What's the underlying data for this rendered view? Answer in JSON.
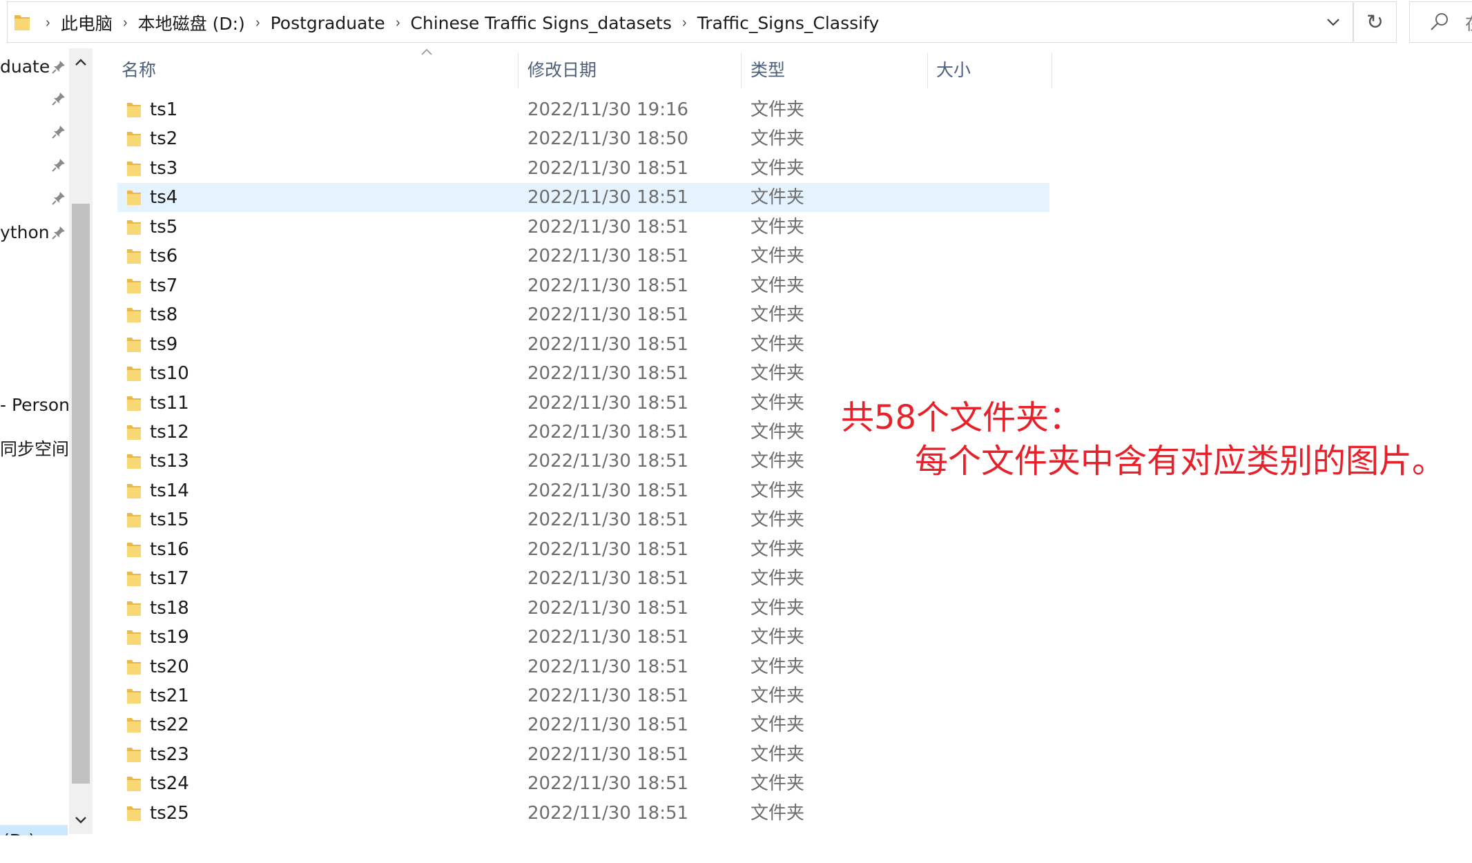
{
  "address_bar": {
    "crumbs": [
      "此电脑",
      "本地磁盘 (D:)",
      "Postgraduate",
      "Chinese Traffic Signs_datasets",
      "Traffic_Signs_Classify"
    ],
    "refresh_glyph": "↻",
    "search_partial_text": "在"
  },
  "nav": {
    "items": [
      {
        "label": "duate",
        "pinned": true
      },
      {
        "label": "",
        "pinned": true
      },
      {
        "label": "",
        "pinned": true
      },
      {
        "label": "",
        "pinned": true
      },
      {
        "label": "",
        "pinned": true
      },
      {
        "label": "ython",
        "pinned": true
      }
    ],
    "onedrive_label": "- Persona",
    "sync_label": "同步空间",
    "drive_label": "(D:)"
  },
  "columns": {
    "name": "名称",
    "date": "修改日期",
    "type": "类型",
    "size": "大小"
  },
  "files": [
    {
      "name": "ts1",
      "date": "2022/11/30 19:16",
      "type": "文件夹"
    },
    {
      "name": "ts2",
      "date": "2022/11/30 18:50",
      "type": "文件夹"
    },
    {
      "name": "ts3",
      "date": "2022/11/30 18:51",
      "type": "文件夹"
    },
    {
      "name": "ts4",
      "date": "2022/11/30 18:51",
      "type": "文件夹",
      "selected": true
    },
    {
      "name": "ts5",
      "date": "2022/11/30 18:51",
      "type": "文件夹"
    },
    {
      "name": "ts6",
      "date": "2022/11/30 18:51",
      "type": "文件夹"
    },
    {
      "name": "ts7",
      "date": "2022/11/30 18:51",
      "type": "文件夹"
    },
    {
      "name": "ts8",
      "date": "2022/11/30 18:51",
      "type": "文件夹"
    },
    {
      "name": "ts9",
      "date": "2022/11/30 18:51",
      "type": "文件夹"
    },
    {
      "name": "ts10",
      "date": "2022/11/30 18:51",
      "type": "文件夹"
    },
    {
      "name": "ts11",
      "date": "2022/11/30 18:51",
      "type": "文件夹"
    },
    {
      "name": "ts12",
      "date": "2022/11/30 18:51",
      "type": "文件夹"
    },
    {
      "name": "ts13",
      "date": "2022/11/30 18:51",
      "type": "文件夹"
    },
    {
      "name": "ts14",
      "date": "2022/11/30 18:51",
      "type": "文件夹"
    },
    {
      "name": "ts15",
      "date": "2022/11/30 18:51",
      "type": "文件夹"
    },
    {
      "name": "ts16",
      "date": "2022/11/30 18:51",
      "type": "文件夹"
    },
    {
      "name": "ts17",
      "date": "2022/11/30 18:51",
      "type": "文件夹"
    },
    {
      "name": "ts18",
      "date": "2022/11/30 18:51",
      "type": "文件夹"
    },
    {
      "name": "ts19",
      "date": "2022/11/30 18:51",
      "type": "文件夹"
    },
    {
      "name": "ts20",
      "date": "2022/11/30 18:51",
      "type": "文件夹"
    },
    {
      "name": "ts21",
      "date": "2022/11/30 18:51",
      "type": "文件夹"
    },
    {
      "name": "ts22",
      "date": "2022/11/30 18:51",
      "type": "文件夹"
    },
    {
      "name": "ts23",
      "date": "2022/11/30 18:51",
      "type": "文件夹"
    },
    {
      "name": "ts24",
      "date": "2022/11/30 18:51",
      "type": "文件夹"
    },
    {
      "name": "ts25",
      "date": "2022/11/30 18:51",
      "type": "文件夹"
    }
  ],
  "annotation": {
    "line1": "共58个文件夹：",
    "line2": "每个文件夹中含有对应类别的图片。",
    "color": "#e8202a"
  },
  "colors": {
    "folder_yellow": "#f8d775",
    "folder_dark": "#e8b84a",
    "selection": "#e5f3ff",
    "nav_selection": "#cce8ff",
    "header_text": "#4c607a"
  }
}
